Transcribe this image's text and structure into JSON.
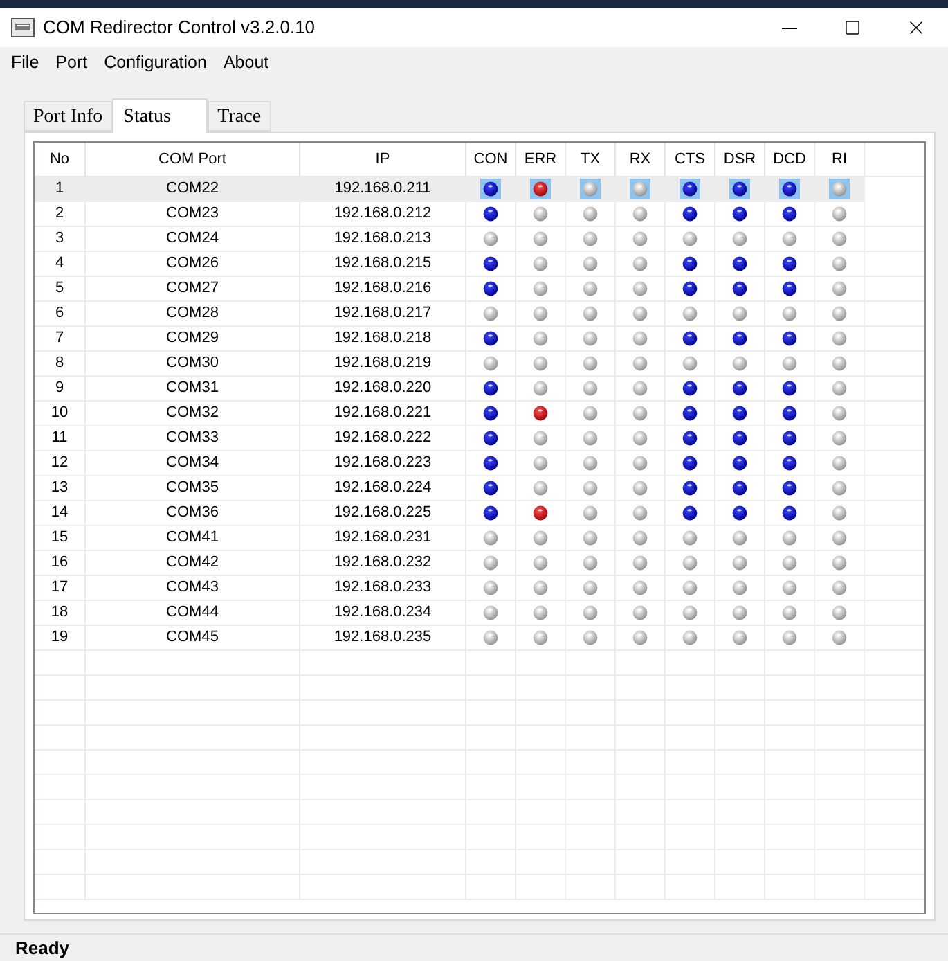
{
  "window": {
    "title": "COM Redirector Control v3.2.0.10"
  },
  "menu": [
    "File",
    "Port",
    "Configuration",
    "About"
  ],
  "tabs": [
    {
      "label": "Port Info",
      "selected": false
    },
    {
      "label": "Status",
      "selected": true
    },
    {
      "label": "Trace",
      "selected": false
    }
  ],
  "columns": [
    "No",
    "COM Port",
    "IP",
    "CON",
    "ERR",
    "TX",
    "RX",
    "CTS",
    "DSR",
    "DCD",
    "RI"
  ],
  "rows": [
    {
      "no": "1",
      "port": "COM22",
      "ip": "192.168.0.211",
      "selected": true,
      "leds": [
        {
          "on": true
        },
        {
          "on": true
        },
        {
          "on": false
        },
        {
          "on": false
        },
        {
          "on": true
        },
        {
          "on": true
        },
        {
          "on": true
        },
        {
          "on": false
        }
      ]
    },
    {
      "no": "2",
      "port": "COM23",
      "ip": "192.168.0.212",
      "selected": false,
      "leds": [
        {
          "on": true
        },
        {
          "on": false
        },
        {
          "on": false
        },
        {
          "on": false
        },
        {
          "on": true
        },
        {
          "on": true
        },
        {
          "on": true
        },
        {
          "on": false
        }
      ]
    },
    {
      "no": "3",
      "port": "COM24",
      "ip": "192.168.0.213",
      "selected": false,
      "leds": [
        {
          "on": false
        },
        {
          "on": false
        },
        {
          "on": false
        },
        {
          "on": false
        },
        {
          "on": false
        },
        {
          "on": false
        },
        {
          "on": false
        },
        {
          "on": false
        }
      ]
    },
    {
      "no": "4",
      "port": "COM26",
      "ip": "192.168.0.215",
      "selected": false,
      "leds": [
        {
          "on": true
        },
        {
          "on": false
        },
        {
          "on": false
        },
        {
          "on": false
        },
        {
          "on": true
        },
        {
          "on": true
        },
        {
          "on": true
        },
        {
          "on": false
        }
      ]
    },
    {
      "no": "5",
      "port": "COM27",
      "ip": "192.168.0.216",
      "selected": false,
      "leds": [
        {
          "on": true
        },
        {
          "on": false
        },
        {
          "on": false
        },
        {
          "on": false
        },
        {
          "on": true
        },
        {
          "on": true
        },
        {
          "on": true
        },
        {
          "on": false
        }
      ]
    },
    {
      "no": "6",
      "port": "COM28",
      "ip": "192.168.0.217",
      "selected": false,
      "leds": [
        {
          "on": false
        },
        {
          "on": false
        },
        {
          "on": false
        },
        {
          "on": false
        },
        {
          "on": false
        },
        {
          "on": false
        },
        {
          "on": false
        },
        {
          "on": false
        }
      ]
    },
    {
      "no": "7",
      "port": "COM29",
      "ip": "192.168.0.218",
      "selected": false,
      "leds": [
        {
          "on": true
        },
        {
          "on": false
        },
        {
          "on": false
        },
        {
          "on": false
        },
        {
          "on": true
        },
        {
          "on": true
        },
        {
          "on": true
        },
        {
          "on": false
        }
      ]
    },
    {
      "no": "8",
      "port": "COM30",
      "ip": "192.168.0.219",
      "selected": false,
      "leds": [
        {
          "on": false
        },
        {
          "on": false
        },
        {
          "on": false
        },
        {
          "on": false
        },
        {
          "on": false
        },
        {
          "on": false
        },
        {
          "on": false
        },
        {
          "on": false
        }
      ]
    },
    {
      "no": "9",
      "port": "COM31",
      "ip": "192.168.0.220",
      "selected": false,
      "leds": [
        {
          "on": true
        },
        {
          "on": false
        },
        {
          "on": false
        },
        {
          "on": false
        },
        {
          "on": true
        },
        {
          "on": true
        },
        {
          "on": true
        },
        {
          "on": false
        }
      ]
    },
    {
      "no": "10",
      "port": "COM32",
      "ip": "192.168.0.221",
      "selected": false,
      "leds": [
        {
          "on": true
        },
        {
          "on": true
        },
        {
          "on": false
        },
        {
          "on": false
        },
        {
          "on": true
        },
        {
          "on": true
        },
        {
          "on": true
        },
        {
          "on": false
        }
      ]
    },
    {
      "no": "11",
      "port": "COM33",
      "ip": "192.168.0.222",
      "selected": false,
      "leds": [
        {
          "on": true
        },
        {
          "on": false
        },
        {
          "on": false
        },
        {
          "on": false
        },
        {
          "on": true
        },
        {
          "on": true
        },
        {
          "on": true
        },
        {
          "on": false
        }
      ]
    },
    {
      "no": "12",
      "port": "COM34",
      "ip": "192.168.0.223",
      "selected": false,
      "leds": [
        {
          "on": true
        },
        {
          "on": false
        },
        {
          "on": false
        },
        {
          "on": false
        },
        {
          "on": true
        },
        {
          "on": true
        },
        {
          "on": true
        },
        {
          "on": false
        }
      ]
    },
    {
      "no": "13",
      "port": "COM35",
      "ip": "192.168.0.224",
      "selected": false,
      "leds": [
        {
          "on": true
        },
        {
          "on": false
        },
        {
          "on": false
        },
        {
          "on": false
        },
        {
          "on": true
        },
        {
          "on": true
        },
        {
          "on": true
        },
        {
          "on": false
        }
      ]
    },
    {
      "no": "14",
      "port": "COM36",
      "ip": "192.168.0.225",
      "selected": false,
      "leds": [
        {
          "on": true
        },
        {
          "on": true
        },
        {
          "on": false
        },
        {
          "on": false
        },
        {
          "on": true
        },
        {
          "on": true
        },
        {
          "on": true
        },
        {
          "on": false
        }
      ]
    },
    {
      "no": "15",
      "port": "COM41",
      "ip": "192.168.0.231",
      "selected": false,
      "leds": [
        {
          "on": false
        },
        {
          "on": false
        },
        {
          "on": false
        },
        {
          "on": false
        },
        {
          "on": false
        },
        {
          "on": false
        },
        {
          "on": false
        },
        {
          "on": false
        }
      ]
    },
    {
      "no": "16",
      "port": "COM42",
      "ip": "192.168.0.232",
      "selected": false,
      "leds": [
        {
          "on": false
        },
        {
          "on": false
        },
        {
          "on": false
        },
        {
          "on": false
        },
        {
          "on": false
        },
        {
          "on": false
        },
        {
          "on": false
        },
        {
          "on": false
        }
      ]
    },
    {
      "no": "17",
      "port": "COM43",
      "ip": "192.168.0.233",
      "selected": false,
      "leds": [
        {
          "on": false
        },
        {
          "on": false
        },
        {
          "on": false
        },
        {
          "on": false
        },
        {
          "on": false
        },
        {
          "on": false
        },
        {
          "on": false
        },
        {
          "on": false
        }
      ]
    },
    {
      "no": "18",
      "port": "COM44",
      "ip": "192.168.0.234",
      "selected": false,
      "leds": [
        {
          "on": false
        },
        {
          "on": false
        },
        {
          "on": false
        },
        {
          "on": false
        },
        {
          "on": false
        },
        {
          "on": false
        },
        {
          "on": false
        },
        {
          "on": false
        }
      ]
    },
    {
      "no": "19",
      "port": "COM45",
      "ip": "192.168.0.235",
      "selected": false,
      "leds": [
        {
          "on": false
        },
        {
          "on": false
        },
        {
          "on": false
        },
        {
          "on": false
        },
        {
          "on": false
        },
        {
          "on": false
        },
        {
          "on": false
        },
        {
          "on": false
        }
      ]
    }
  ],
  "status_bar": "Ready"
}
